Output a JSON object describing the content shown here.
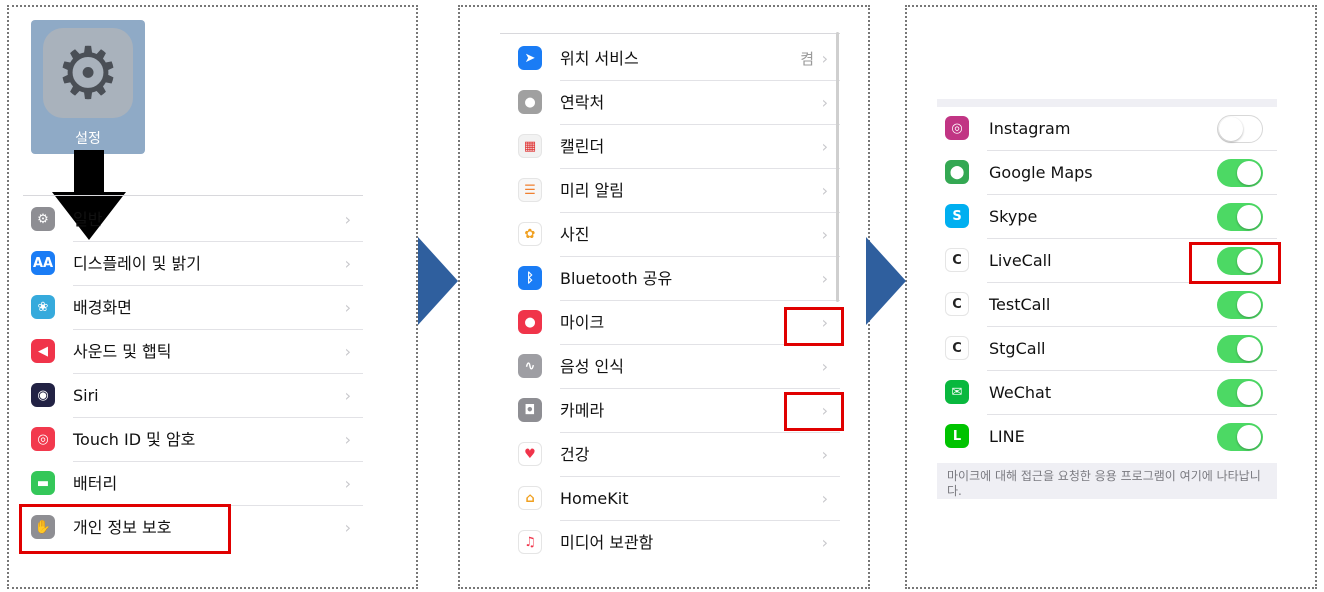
{
  "panel1": {
    "app_icon_caption": "설정",
    "items": [
      {
        "label": "일반",
        "icon": "gear-icon",
        "color": "#8e8e93"
      },
      {
        "label": "디스플레이 및 밝기",
        "icon": "aa-icon",
        "color": "#1a7cf5"
      },
      {
        "label": "배경화면",
        "icon": "flower-icon",
        "color": "#36aadc"
      },
      {
        "label": "사운드 및 햅틱",
        "icon": "speaker-icon",
        "color": "#f0344a"
      },
      {
        "label": "Siri",
        "icon": "siri-icon",
        "color": "#222244"
      },
      {
        "label": "Touch ID 및 암호",
        "icon": "fingerprint-icon",
        "color": "#f2394d"
      },
      {
        "label": "배터리",
        "icon": "battery-icon",
        "color": "#34c759"
      },
      {
        "label": "개인 정보 보호",
        "icon": "hand-icon",
        "color": "#8e8e93"
      }
    ]
  },
  "panel2": {
    "items": [
      {
        "label": "위치 서비스",
        "value": "켬",
        "icon": "location-icon",
        "color": "#1a7cf5"
      },
      {
        "label": "연락처",
        "value": "",
        "icon": "contacts-icon",
        "color": "#a0a0a0"
      },
      {
        "label": "캘린더",
        "value": "",
        "icon": "calendar-icon",
        "color": "#f2f2f2"
      },
      {
        "label": "미리 알림",
        "value": "",
        "icon": "reminders-icon",
        "color": "#f7f7f7"
      },
      {
        "label": "사진",
        "value": "",
        "icon": "photos-icon",
        "color": "#ffffff"
      },
      {
        "label": "Bluetooth 공유",
        "value": "",
        "icon": "bluetooth-icon",
        "color": "#1a7cf5"
      },
      {
        "label": "마이크",
        "value": "",
        "icon": "microphone-icon",
        "color": "#f0344a"
      },
      {
        "label": "음성 인식",
        "value": "",
        "icon": "waveform-icon",
        "color": "#9e9ea3"
      },
      {
        "label": "카메라",
        "value": "",
        "icon": "camera-icon",
        "color": "#8e8e93"
      },
      {
        "label": "건강",
        "value": "",
        "icon": "heart-icon",
        "color": "#ffffff"
      },
      {
        "label": "HomeKit",
        "value": "",
        "icon": "home-icon",
        "color": "#ffffff"
      },
      {
        "label": "미디어 보관함",
        "value": "",
        "icon": "music-icon",
        "color": "#ffffff"
      }
    ]
  },
  "panel3": {
    "apps": [
      {
        "label": "Instagram",
        "on": false,
        "icon": "instagram-icon",
        "color": "#c13584"
      },
      {
        "label": "Google Maps",
        "on": true,
        "icon": "google-maps-icon",
        "color": "#34a853"
      },
      {
        "label": "Skype",
        "on": true,
        "icon": "skype-icon",
        "color": "#00aff0"
      },
      {
        "label": "LiveCall",
        "on": true,
        "icon": "livecall-icon",
        "color": "#ffffff"
      },
      {
        "label": "TestCall",
        "on": true,
        "icon": "testcall-icon",
        "color": "#ffffff"
      },
      {
        "label": "StgCall",
        "on": true,
        "icon": "stgcall-icon",
        "color": "#ffffff"
      },
      {
        "label": "WeChat",
        "on": true,
        "icon": "wechat-icon",
        "color": "#09b83e"
      },
      {
        "label": "LINE",
        "on": true,
        "icon": "line-icon",
        "color": "#00c300"
      }
    ],
    "footer": "마이크에 대해 접근을 요청한 응용 프로그램이 여기에 나타납니다."
  },
  "colors": {
    "highlight": "#e00000",
    "arrow": "#2f5f9e",
    "toggle_on": "#4cd964"
  }
}
